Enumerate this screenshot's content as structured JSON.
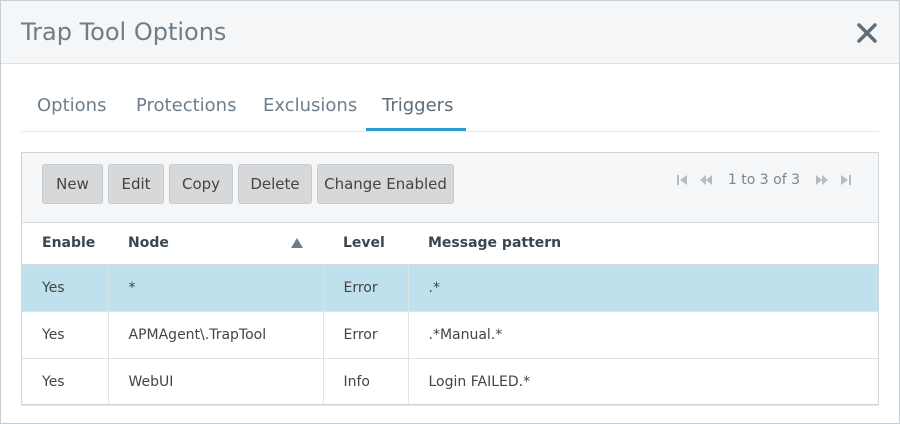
{
  "dialog": {
    "title": "Trap Tool Options"
  },
  "tabs": [
    {
      "label": "Options"
    },
    {
      "label": "Protections"
    },
    {
      "label": "Exclusions"
    },
    {
      "label": "Triggers",
      "active": true
    }
  ],
  "toolbar": {
    "new_label": "New",
    "edit_label": "Edit",
    "copy_label": "Copy",
    "delete_label": "Delete",
    "change_enabled_label": "Change Enabled"
  },
  "pager": {
    "text": "1 to 3 of 3"
  },
  "table": {
    "columns": [
      "Enable",
      "Node",
      "Level",
      "Message pattern"
    ],
    "sort": {
      "column": "Node",
      "direction": "ascending"
    },
    "rows": [
      {
        "enable": "Yes",
        "node": "*",
        "level": "Error",
        "pattern": ".*",
        "selected": true
      },
      {
        "enable": "Yes",
        "node": "APMAgent\\.TrapTool",
        "level": "Error",
        "pattern": ".*Manual.*"
      },
      {
        "enable": "Yes",
        "node": "WebUI",
        "level": "Info",
        "pattern": "Login FAILED.*"
      }
    ]
  },
  "colors": {
    "accent": "#2d9bcc",
    "selected_row": "#bfe1ee",
    "header_bg": "#f4f6f8"
  },
  "icons": {
    "close": "close-icon",
    "sort": "sort-asc-icon",
    "first": "first-page-icon",
    "prev": "prev-page-icon",
    "next": "next-page-icon",
    "last": "last-page-icon"
  }
}
